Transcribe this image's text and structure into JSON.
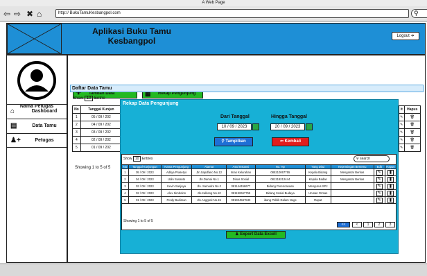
{
  "browser": {
    "title": "A Web Page",
    "url": "http:// BukuTamuKesbangpol.com",
    "search_icon": "search-icon"
  },
  "header": {
    "title": "Aplikasi Buku Tamu Kesbangpol",
    "logout_label": "Logout"
  },
  "sidebar": {
    "officer_label": "Nama Petugas",
    "items": [
      {
        "label": "Dashboard",
        "icon": "home-icon"
      },
      {
        "label": "Data Tamu",
        "icon": "book-icon"
      },
      {
        "label": "Petugas",
        "icon": "add-user-icon"
      }
    ]
  },
  "main": {
    "btn_tambah": "Tambah Data",
    "btn_rekap": "Rekap Pengunjung",
    "panel_title": "Daftar Data Tamu",
    "show_label": "Show",
    "entries_value": "10",
    "entries_label": "Entrie",
    "columns": [
      "No",
      "Tanggal Kunjun"
    ],
    "rows": [
      [
        "1",
        "05 / 09 / 202"
      ],
      [
        "2",
        "04 / 09 / 202"
      ],
      [
        "3",
        "03 / 09 / 202"
      ],
      [
        "4",
        "02 / 09 / 202"
      ],
      [
        "5",
        "01 / 09 / 202"
      ]
    ],
    "showing": "Showing 1 to 5 of 5",
    "right_cols": [
      "it",
      "Hapus"
    ]
  },
  "modal": {
    "title": "Rekap Data Pengunjung",
    "dari_label": "Dari Tanggal",
    "dari_value": "10 / 09 / 2023",
    "hingga_label": "Hingga Tanggal",
    "hingga_value": "20 / 09 / 2023",
    "tampilkan": "Tampilkan",
    "kembali": "Kembali",
    "show_label": "Show",
    "entries_value": "10",
    "entries_label": "Entries",
    "search_placeholder": "search",
    "columns": [
      "No",
      "Tanggal Kunjungan",
      "Nama Pengunjung",
      "Alamat",
      "Asal Instansi",
      "No. Hp",
      "Yang Ditui",
      "Kepentingan Bertemu",
      "Edit",
      "Hapus"
    ],
    "rows": [
      [
        "1",
        "05 / 09 / 2023",
        "Aditya Prasetyo",
        "Jln.Sapdfano No.12",
        "Imas Kelurahan",
        "085210067755",
        "Kepala Bidang",
        "Mengantar Berkas"
      ],
      [
        "2",
        "04 / 09 / 2023",
        "Udin Susanto",
        "Jln.Damai No.1",
        "Dinas Sosial",
        "081219212444",
        "Kepala Badan",
        "Mengantar Berkas"
      ],
      [
        "3",
        "03 / 09 / 2023",
        "Kevin Sanjaya",
        "Jln. Samudra No.2",
        "081144456677",
        "Bidang Perencanaan",
        "Mengurus SPJ",
        ""
      ],
      [
        "4",
        "02 / 09 / 2023",
        "Alex Simbolon",
        "Jln.Kalitang No.10",
        "081192667755",
        "Bidang Sosial Budaya",
        "Urusan Ormas",
        ""
      ],
      [
        "5",
        "01 / 09 / 2023",
        "Fredy Budiman",
        "Jln.Anggrek No.15",
        "081924567843",
        "idang Politik Dalam Nege",
        "Rapat",
        ""
      ]
    ],
    "showing": "Showing 1 to 5 of 5",
    "pagination": [
      "<<",
      "<",
      "1",
      "2",
      "3"
    ],
    "export_label": "Export Data Excell"
  },
  "colors": {
    "header": "#1e8fd6",
    "modal": "#17b0d6",
    "green": "#23b923",
    "red": "#e21c1c"
  }
}
